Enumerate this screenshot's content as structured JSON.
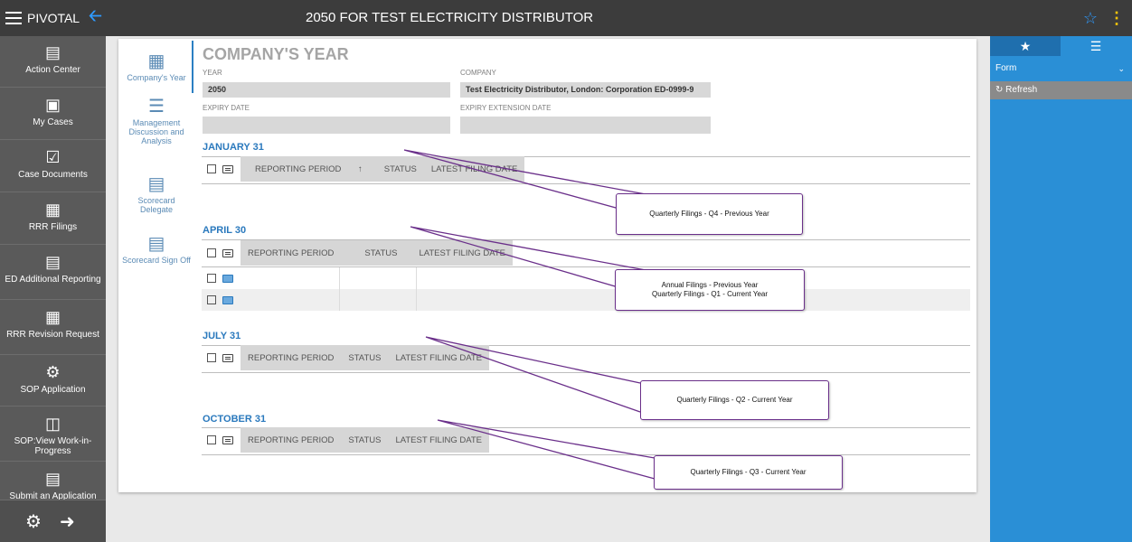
{
  "topbar": {
    "app_name": "PIVOTAL",
    "title": "2050 FOR TEST ELECTRICITY DISTRIBUTOR"
  },
  "sidebar": {
    "items": [
      {
        "label": "Action Center",
        "icon": "action-center-icon"
      },
      {
        "label": "My Cases",
        "icon": "cases-icon"
      },
      {
        "label": "Case Documents",
        "icon": "checkbox-icon"
      },
      {
        "label": "RRR Filings",
        "icon": "building-icon"
      },
      {
        "label": "ED Additional Reporting",
        "icon": "document-icon"
      },
      {
        "label": "RRR Revision Request",
        "icon": "building-icon"
      },
      {
        "label": "SOP Application",
        "icon": "globe-icon"
      },
      {
        "label": "SOP:View Work-in-Progress",
        "icon": "documents-icon"
      },
      {
        "label": "Submit an Application",
        "icon": "document-icon"
      }
    ]
  },
  "subnav": {
    "items": [
      {
        "label": "Company's Year"
      },
      {
        "label": "Management Discussion and Analysis"
      },
      {
        "label": "Scorecard Delegate"
      },
      {
        "label": "Scorecard Sign Off"
      }
    ]
  },
  "form": {
    "section_title": "COMPANY'S YEAR",
    "year_label": "YEAR",
    "year_value": "2050",
    "company_label": "COMPANY",
    "company_value": "Test Electricity Distributor, London: Corporation ED-0999-9",
    "expiry_label": "EXPIRY DATE",
    "expiry_value": "",
    "expiry_ext_label": "EXPIRY EXTENSION DATE",
    "expiry_ext_value": ""
  },
  "periods": [
    {
      "title": "JANUARY 31",
      "col1": "REPORTING PERIOD",
      "sort_arrow": "↑",
      "col2": "STATUS",
      "col3": "LATEST FILING DATE"
    },
    {
      "title": "APRIL 30",
      "col1": "REPORTING PERIOD",
      "col2": "STATUS",
      "col3": "LATEST FILING DATE"
    },
    {
      "title": "JULY 31",
      "col1": "REPORTING PERIOD",
      "col2": "STATUS",
      "col3": "LATEST FILING DATE"
    },
    {
      "title": "OCTOBER 31",
      "col1": "REPORTING PERIOD",
      "col2": "STATUS",
      "col3": "LATEST FILING DATE"
    }
  ],
  "right_panel": {
    "form_label": "Form",
    "refresh_label": "Refresh"
  },
  "callouts": {
    "c1": "Quarterly Filings - Q4 - Previous Year",
    "c2_line1": "Annual Filings - Previous Year",
    "c2_line2": "Quarterly Filings - Q1 - Current Year",
    "c3": "Quarterly Filings - Q2 - Current Year",
    "c4": "Quarterly Filings - Q3 - Current Year"
  },
  "colors": {
    "topbar": "#3c3c3c",
    "sidebar": "#5a5a5a",
    "accent_blue": "#2a79bd",
    "right_panel": "#2a8fd6",
    "callout_border": "#6a2f8a"
  }
}
